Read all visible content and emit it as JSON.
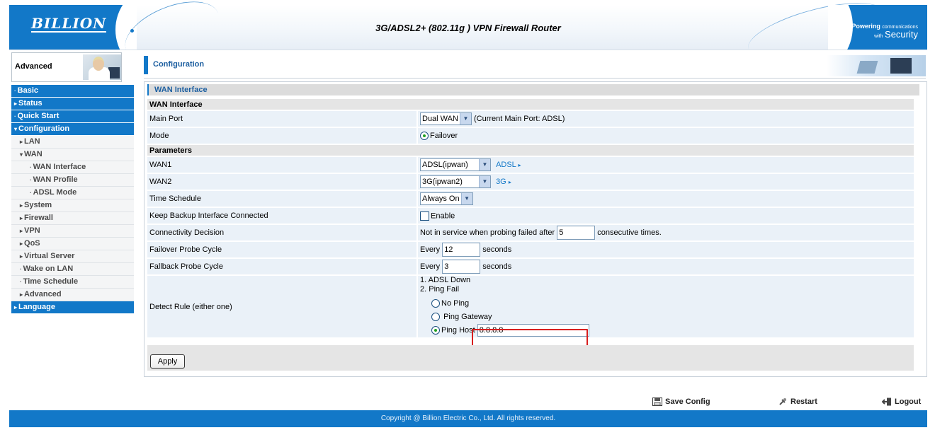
{
  "header": {
    "logo": "BILLION",
    "title": "3G/ADSL2+ (802.11g ) VPN Firewall Router",
    "tagline_small": "Powering",
    "tagline_small2": "communications",
    "tagline_with": "with",
    "tagline_big": "Security"
  },
  "sidebar": {
    "section_label": "Advanced",
    "items": [
      {
        "label": "Basic",
        "level": "main",
        "arrow": "·"
      },
      {
        "label": "Status",
        "level": "main",
        "arrow": "▸"
      },
      {
        "label": "Quick Start",
        "level": "main",
        "arrow": "·"
      },
      {
        "label": "Configuration",
        "level": "main",
        "arrow": "▾"
      },
      {
        "label": "LAN",
        "level": "sub",
        "arrow": "▸"
      },
      {
        "label": "WAN",
        "level": "sub",
        "arrow": "▾"
      },
      {
        "label": "WAN Interface",
        "level": "sub2",
        "arrow": "·"
      },
      {
        "label": "WAN Profile",
        "level": "sub2",
        "arrow": "·"
      },
      {
        "label": "ADSL Mode",
        "level": "sub2",
        "arrow": "·"
      },
      {
        "label": "System",
        "level": "sub",
        "arrow": "▸"
      },
      {
        "label": "Firewall",
        "level": "sub",
        "arrow": "▸"
      },
      {
        "label": "VPN",
        "level": "sub",
        "arrow": "▸"
      },
      {
        "label": "QoS",
        "level": "sub",
        "arrow": "▸"
      },
      {
        "label": "Virtual Server",
        "level": "sub",
        "arrow": "▸"
      },
      {
        "label": "Wake on LAN",
        "level": "sub",
        "arrow": "·"
      },
      {
        "label": "Time Schedule",
        "level": "sub",
        "arrow": "·"
      },
      {
        "label": "Advanced",
        "level": "sub",
        "arrow": "▸"
      },
      {
        "label": "Language",
        "level": "main",
        "arrow": "▸"
      }
    ]
  },
  "main": {
    "page_title": "Configuration",
    "panel_title": "WAN Interface",
    "section_wan": "WAN Interface",
    "main_port_label": "Main Port",
    "main_port_value": "Dual WAN",
    "main_port_note": "(Current Main Port: ADSL)",
    "mode_label": "Mode",
    "mode_value": "Failover",
    "section_params": "Parameters",
    "wan1_label": "WAN1",
    "wan1_value": "ADSL(ipwan)",
    "wan1_link": "ADSL",
    "wan2_label": "WAN2",
    "wan2_value": "3G(ipwan2)",
    "wan2_link": "3G",
    "schedule_label": "Time Schedule",
    "schedule_value": "Always On",
    "keep_label": "Keep Backup Interface Connected",
    "keep_value": "Enable",
    "conn_label": "Connectivity Decision",
    "conn_prefix": "Not in service when probing failed after",
    "conn_value": "5",
    "conn_suffix": "consecutive times.",
    "failover_label": "Failover Probe Cycle",
    "failover_prefix": "Every",
    "failover_value": "12",
    "failover_suffix": "seconds",
    "fallback_label": "Fallback Probe Cycle",
    "fallback_prefix": "Every",
    "fallback_value": "3",
    "fallback_suffix": "seconds",
    "detect_label": "Detect Rule (either one)",
    "detect_line1": "1. ADSL Down",
    "detect_line2": "2. Ping Fail",
    "opt_no_ping": "No Ping",
    "opt_ping_gateway": "Ping Gateway",
    "opt_ping_host": "Ping Host",
    "ping_host_value": "8.8.8.8",
    "apply_label": "Apply"
  },
  "footer": {
    "save_label": "Save Config",
    "restart_label": "Restart",
    "logout_label": "Logout",
    "copyright": "Copyright @ Billion Electric Co., Ltd. All rights reserved."
  },
  "colors": {
    "brand_blue": "#1278c8",
    "row_bg": "#eaf1f8",
    "highlight": "#d81f1f"
  }
}
